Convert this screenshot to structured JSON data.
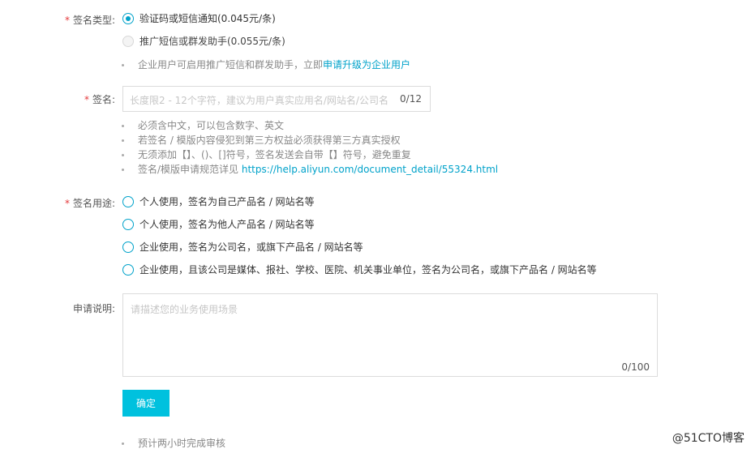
{
  "sign_type": {
    "label": "签名类型:",
    "options": [
      {
        "label": "验证码或短信通知(0.045元/条)",
        "checked": true,
        "disabled": false
      },
      {
        "label": "推广短信或群发助手(0.055元/条)",
        "checked": false,
        "disabled": true
      }
    ],
    "tip_prefix": "企业用户可启用推广短信和群发助手，立即",
    "tip_link": "申请升级为企业用户"
  },
  "signature": {
    "label": "签名:",
    "placeholder": "长度限2 - 12个字符，建议为用户真实应用名/网站名/公司名",
    "counter": "0/12",
    "tips": [
      "必须含中文，可以包含数字、英文",
      "若签名 / 模版内容侵犯到第三方权益必须获得第三方真实授权",
      "无须添加【】、()、[]符号，签名发送会自带【】符号，避免重复"
    ],
    "spec_prefix": "签名/模版申请规范详见",
    "spec_link": "https://help.aliyun.com/document_detail/55324.html"
  },
  "usage": {
    "label": "签名用途:",
    "options": [
      "个人使用，签名为自己产品名 / 网站名等",
      "个人使用，签名为他人产品名 / 网站名等",
      "企业使用，签名为公司名，或旗下产品名 / 网站名等",
      "企业使用，且该公司是媒体、报社、学校、医院、机关事业单位，签名为公司名，或旗下产品名 / 网站名等"
    ]
  },
  "description": {
    "label": "申请说明:",
    "placeholder": "请描述您的业务使用场景",
    "counter": "0/100"
  },
  "submit_label": "确定",
  "footer_tip": "预计两小时完成审核",
  "watermark": "@51CTO博客",
  "colors": {
    "accent": "#00a2ca",
    "button": "#00c1de",
    "required": "#e4393c"
  }
}
